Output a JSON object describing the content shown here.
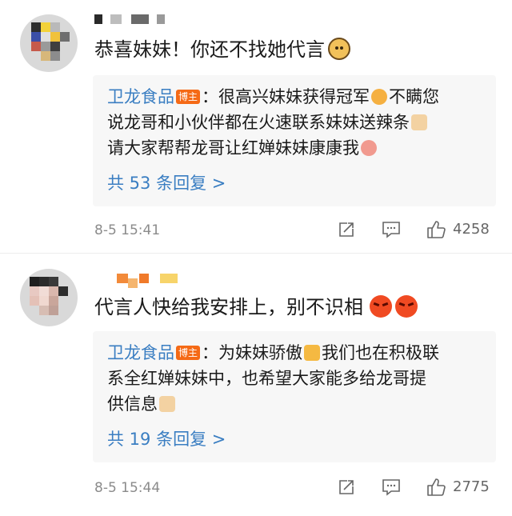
{
  "comments": [
    {
      "text": "恭喜妹妹！你还不找她代言",
      "reply": {
        "author": "卫龙食品",
        "badge": "博主",
        "lines": [
          "：很高兴妹妹获得冠军",
          "不瞒您",
          "说龙哥和小伙伴都在火速联系妹妹送辣条",
          "请大家帮帮龙哥让红婵妹妹康康我"
        ],
        "more": "共 53 条回复 >"
      },
      "time": "8-5 15:41",
      "likes": "4258"
    },
    {
      "text": "代言人快给我安排上，别不识相",
      "reply": {
        "author": "卫龙食品",
        "badge": "博主",
        "lines": [
          "：为妹妹骄傲",
          "我们也在积极联",
          "系全红婵妹妹中，也希望大家能多给龙哥提",
          "供信息"
        ],
        "more": "共 19 条回复 >"
      },
      "time": "8-5 15:44",
      "likes": "2775"
    }
  ],
  "icons": {
    "share": "share-icon",
    "comment": "comment-icon",
    "like": "thumbs-up-icon"
  },
  "colors": {
    "link": "#3a7ec2",
    "badge": "#f56a16",
    "meta": "#8b8b8b",
    "reply_bg": "#f7f7f7"
  }
}
